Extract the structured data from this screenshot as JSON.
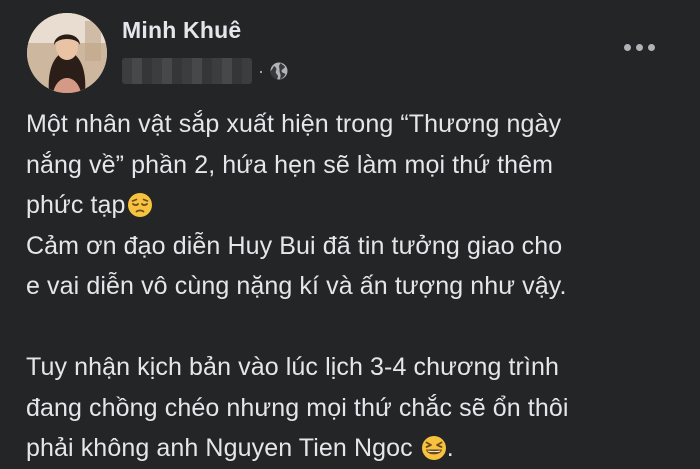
{
  "post": {
    "author_name": "Minh Khuê",
    "timestamp_blurred": "",
    "privacy_icon": "globe-icon",
    "more_icon": "ellipsis-horizontal-icon",
    "lines": [
      "Một nhân vật sắp xuất hiện trong “Thương ngày",
      "nắng về” phần 2, hứa hẹn sẽ làm mọi thứ thêm",
      "phức tạp",
      "Cảm ơn đạo diễn Huy Bui đã tin tưởng giao cho",
      "e vai diễn vô cùng nặng kí và ấn tượng như vậy.",
      "",
      "Tuy nhận kịch bản vào lúc lịch 3-4 chương trình",
      "đang chồng chéo nhưng mọi thứ chắc sẽ ổn thôi",
      "phải không anh Nguyen Tien Ngoc"
    ],
    "line_9_suffix": ".",
    "emojis": [
      "pensive-face-emoji",
      "grinning-squinting-face-emoji"
    ]
  },
  "colors": {
    "background": "#242526",
    "text_primary": "#e4e6eb",
    "text_secondary": "#b0b3b8",
    "emoji_yellow": "#f7c23e"
  }
}
